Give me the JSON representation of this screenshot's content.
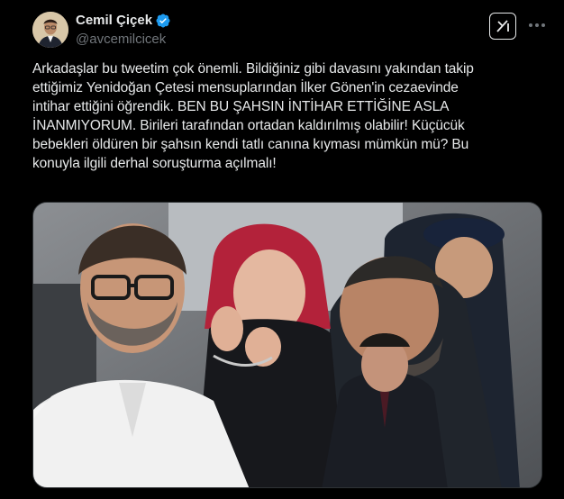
{
  "author": {
    "display_name": "Cemil Çiçek",
    "handle": "@avcemilcicek",
    "verified": true,
    "verified_color": "#1d9bf0"
  },
  "tweet": {
    "text": "Arkadaşlar bu tweetim çok önemli. Bildiğiniz gibi davasını yakından takip\nettiğimiz Yenidoğan Çetesi mensuplarından İlker Gönen'in cezaevinde\nintihar ettiğini öğrendik. BEN BU ŞAHSIN İNTİHAR ETTİĞİNE ASLA\nİNANMIYORUM. Birileri tarafından ortadan kaldırılmış olabilir! Küçücük\nbebekleri öldüren bir şahsın kendi tatlı canına kıyması mümkün mü? Bu\nkonuyla ilgili derhal soruşturma açılmalı!"
  },
  "icons": {
    "grok": "grok-icon",
    "more": "more-icon",
    "verified": "verified-badge-icon"
  },
  "colors": {
    "background": "#000000",
    "text": "#e7e9ea",
    "secondary": "#71767b"
  }
}
